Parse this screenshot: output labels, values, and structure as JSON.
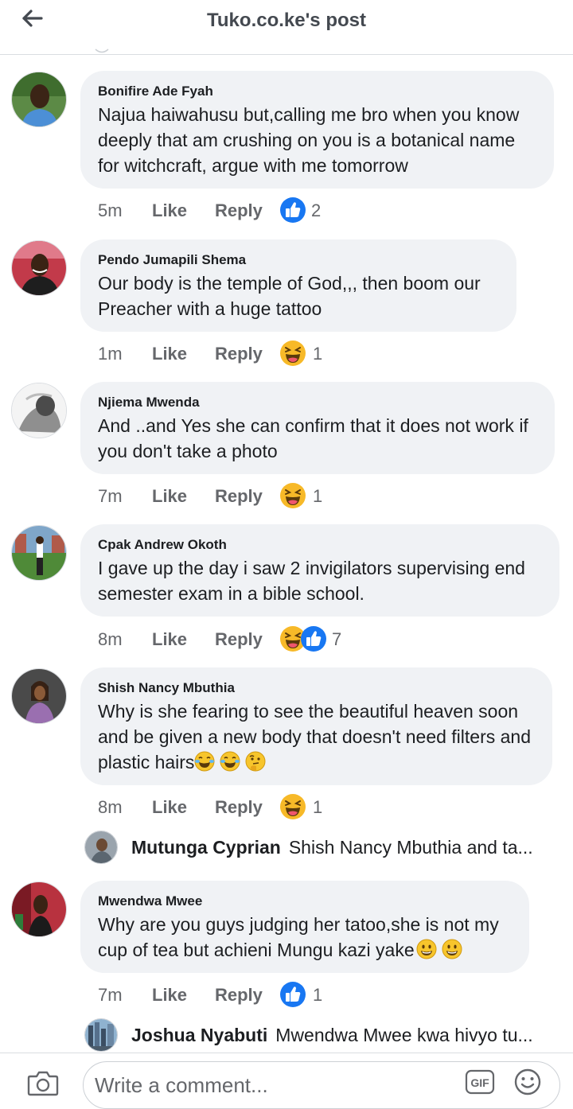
{
  "header": {
    "title": "Tuko.co.ke's post"
  },
  "actions_labels": {
    "like": "Like",
    "reply": "Reply"
  },
  "comments": [
    {
      "author": "Bonifire Ade Fyah",
      "text": "Najua haiwahusu but,calling me bro when you know deeply that am crushing on you is a botanical name for witchcraft, argue with me tomorrow",
      "time": "5m",
      "reactions": [
        "like"
      ],
      "reaction_count": "2"
    },
    {
      "author": "Pendo Jumapili Shema",
      "text": "Our body is the temple of God,,, then boom our Preacher with a huge tattoo",
      "time": "1m",
      "reactions": [
        "haha"
      ],
      "reaction_count": "1"
    },
    {
      "author": "Njiema Mwenda",
      "text": "And ..and Yes she can confirm that it does not work if you don't take a photo",
      "time": "7m",
      "reactions": [
        "haha"
      ],
      "reaction_count": "1"
    },
    {
      "author": "Cpak Andrew Okoth",
      "text": "I gave up the day i saw 2 invigilators supervising end semester exam in a bible school.",
      "time": "8m",
      "reactions": [
        "haha",
        "like"
      ],
      "reaction_count": "7"
    },
    {
      "author": "Shish Nancy Mbuthia",
      "text": "Why is she fearing to see the beautiful heaven soon and be given a new body that doesn't need filters and plastic hairs",
      "text_emojis": [
        "tears-of-joy",
        "tears-of-joy",
        "thinking"
      ],
      "time": "8m",
      "reactions": [
        "haha"
      ],
      "reaction_count": "1",
      "reply_preview": {
        "author": "Mutunga Cyprian",
        "text": "Shish Nancy Mbuthia and ta..."
      }
    },
    {
      "author": "Mwendwa Mwee",
      "text": "Why are you guys judging her tatoo,she is not my cup of tea but achieni Mungu kazi yake",
      "text_emojis": [
        "grinning",
        "grinning"
      ],
      "time": "7m",
      "reactions": [
        "like"
      ],
      "reaction_count": "1",
      "reply_preview": {
        "author": "Joshua Nyabuti",
        "text": "Mwendwa Mwee kwa hivyo tu..."
      }
    }
  ],
  "composer": {
    "placeholder": "Write a comment...",
    "gif_label": "GIF"
  },
  "icons": {
    "back": "arrow-left-icon",
    "camera": "camera-icon",
    "gif": "gif-icon",
    "emoji": "smiley-icon",
    "like_reaction": "like-reaction-icon",
    "haha_reaction": "haha-reaction-icon"
  },
  "colors": {
    "like_blue": "#1877f2",
    "haha_yellow": "#f7b928",
    "bubble": "#f0f2f5",
    "meta_text": "#65676b"
  }
}
